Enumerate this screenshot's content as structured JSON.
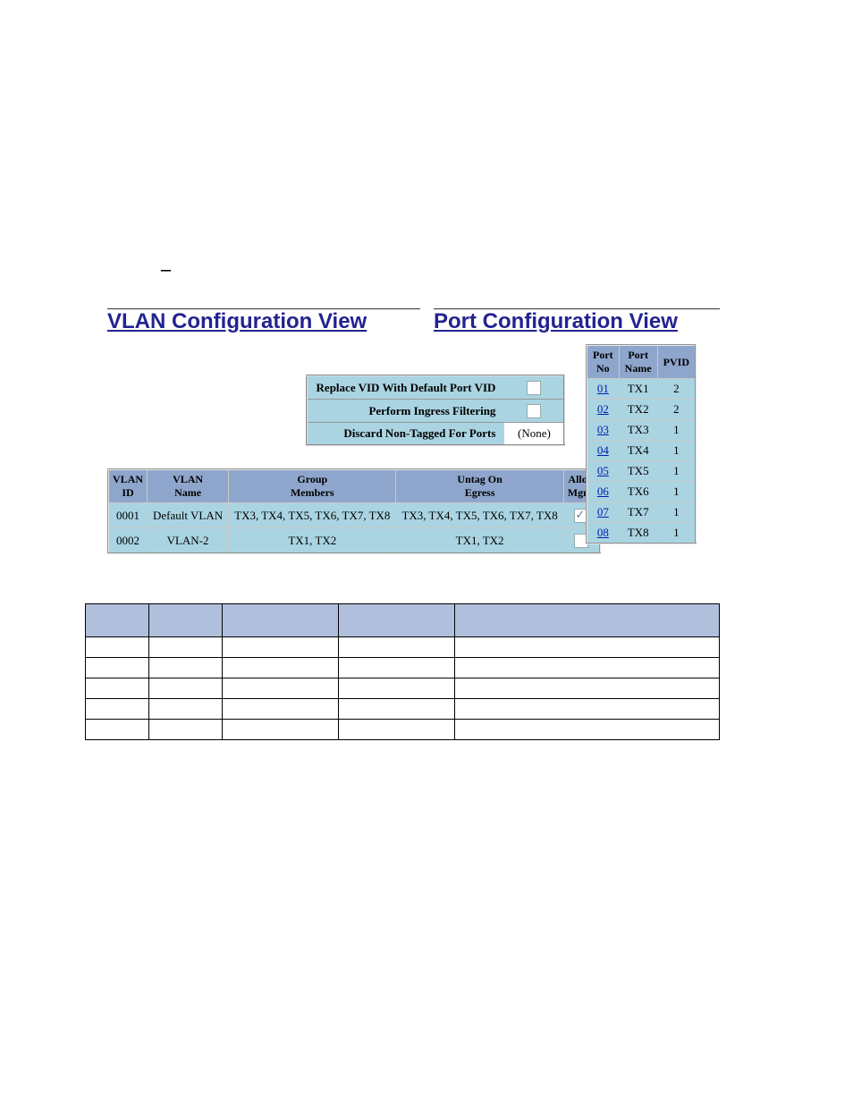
{
  "headings": {
    "vlan": "VLAN Configuration View",
    "port": "Port Configuration View"
  },
  "options": {
    "replace_vid": {
      "label": "Replace VID With Default Port VID",
      "checked": false
    },
    "ingress_filter": {
      "label": "Perform Ingress Filtering",
      "checked": false
    },
    "discard_nontagged": {
      "label": "Discard Non-Tagged For Ports",
      "value": "(None)"
    }
  },
  "vlan_table": {
    "headers": [
      "VLAN\nID",
      "VLAN\nName",
      "Group\nMembers",
      "Untag On\nEgress",
      "Allow\nMgmt"
    ],
    "rows": [
      {
        "id": "0001",
        "name": "Default VLAN",
        "members": "TX3, TX4, TX5, TX6, TX7, TX8",
        "untag": "TX3, TX4, TX5, TX6, TX7, TX8",
        "allow_mgmt": true
      },
      {
        "id": "0002",
        "name": "VLAN-2",
        "members": "TX1, TX2",
        "untag": "TX1, TX2",
        "allow_mgmt": false
      }
    ]
  },
  "port_table": {
    "headers": [
      "Port\nNo",
      "Port\nName",
      "PVID"
    ],
    "rows": [
      {
        "no": "01",
        "name": "TX1",
        "pvid": "2"
      },
      {
        "no": "02",
        "name": "TX2",
        "pvid": "2"
      },
      {
        "no": "03",
        "name": "TX3",
        "pvid": "1"
      },
      {
        "no": "04",
        "name": "TX4",
        "pvid": "1"
      },
      {
        "no": "05",
        "name": "TX5",
        "pvid": "1"
      },
      {
        "no": "06",
        "name": "TX6",
        "pvid": "1"
      },
      {
        "no": "07",
        "name": "TX7",
        "pvid": "1"
      },
      {
        "no": "08",
        "name": "TX8",
        "pvid": "1"
      }
    ]
  },
  "blank_table": {
    "columns": 5,
    "rows": 5
  },
  "colors": {
    "heading_link": "#232391",
    "table_header_bg": "#8fa6cc",
    "table_cell_bg": "#aad4e2",
    "blank_header_bg": "#b0c0dc"
  }
}
